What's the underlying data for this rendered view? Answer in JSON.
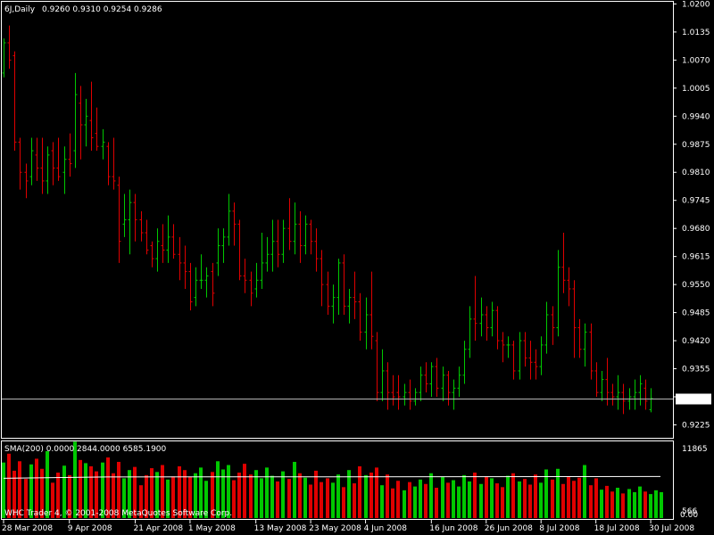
{
  "header": {
    "symbol_timeframe": "6J,Daily",
    "ohlc": "0.9260 0.9310 0.9254 0.9286"
  },
  "indicator": {
    "label": "SMA(200) 0.0000 2844.0000 6585.1900",
    "max_label": "11865",
    "min_label": "566",
    "zero_label": "0.00"
  },
  "footer": {
    "copyright": "WHC Trader 4, © 2001-2008 MetaQuotes Software Corp."
  },
  "current_price": "0.9286",
  "colors": {
    "background": "#000000",
    "up": "#00c800",
    "down": "#e00000",
    "frame": "#ffffff",
    "price_line": "#b4b4b4",
    "sma": "#ffffff"
  },
  "chart_data": [
    {
      "type": "ohlc",
      "price_axis": {
        "ticks": [
          "1.0200",
          "1.0135",
          "1.0070",
          "1.0005",
          "0.9940",
          "0.9875",
          "0.9810",
          "0.9745",
          "0.9680",
          "0.9615",
          "0.9550",
          "0.9485",
          "0.9420",
          "0.9355",
          "0.9290",
          "0.9225"
        ],
        "range": [
          0.9195,
          1.0205
        ]
      },
      "x_labels": [
        {
          "label": "28 Mar 2008",
          "bar": 0
        },
        {
          "label": "9 Apr 2008",
          "bar": 12
        },
        {
          "label": "21 Apr 2008",
          "bar": 24
        },
        {
          "label": "1 May 2008",
          "bar": 34
        },
        {
          "label": "13 May 2008",
          "bar": 46
        },
        {
          "label": "23 May 2008",
          "bar": 56
        },
        {
          "label": "4 Jun 2008",
          "bar": 66
        },
        {
          "label": "16 Jun 2008",
          "bar": 78
        },
        {
          "label": "26 Jun 2008",
          "bar": 88
        },
        {
          "label": "8 Jul 2008",
          "bar": 98
        },
        {
          "label": "18 Jul 2008",
          "bar": 108
        },
        {
          "label": "30 Jul 2008",
          "bar": 118
        }
      ],
      "bars": [
        [
          1.004,
          1.012,
          1.003,
          1.011
        ],
        [
          1.011,
          1.015,
          1.005,
          1.007
        ],
        [
          1.008,
          1.009,
          0.986,
          0.988
        ],
        [
          0.988,
          0.989,
          0.977,
          0.981
        ],
        [
          0.981,
          0.983,
          0.975,
          0.979
        ],
        [
          0.98,
          0.989,
          0.978,
          0.986
        ],
        [
          0.985,
          0.989,
          0.979,
          0.982
        ],
        [
          0.982,
          0.989,
          0.976,
          0.979
        ],
        [
          0.979,
          0.987,
          0.976,
          0.985
        ],
        [
          0.986,
          0.988,
          0.978,
          0.982
        ],
        [
          0.982,
          0.989,
          0.979,
          0.98
        ],
        [
          0.981,
          0.987,
          0.976,
          0.984
        ],
        [
          0.984,
          0.99,
          0.98,
          0.983
        ],
        [
          0.986,
          1.004,
          0.982,
          0.999
        ],
        [
          0.997,
          1.001,
          0.984,
          0.992
        ],
        [
          0.992,
          0.998,
          0.987,
          0.994
        ],
        [
          0.993,
          1.002,
          0.986,
          0.989
        ],
        [
          0.99,
          0.996,
          0.986,
          0.987
        ],
        [
          0.987,
          0.991,
          0.984,
          0.988
        ],
        [
          0.987,
          0.988,
          0.978,
          0.98
        ],
        [
          0.98,
          0.989,
          0.977,
          0.979
        ],
        [
          0.978,
          0.98,
          0.96,
          0.965
        ],
        [
          0.969,
          0.976,
          0.966,
          0.97
        ],
        [
          0.97,
          0.977,
          0.962,
          0.974
        ],
        [
          0.974,
          0.976,
          0.965,
          0.97
        ],
        [
          0.97,
          0.972,
          0.965,
          0.967
        ],
        [
          0.967,
          0.97,
          0.962,
          0.963
        ],
        [
          0.964,
          0.965,
          0.959,
          0.961
        ],
        [
          0.961,
          0.968,
          0.958,
          0.965
        ],
        [
          0.964,
          0.969,
          0.96,
          0.963
        ],
        [
          0.963,
          0.971,
          0.96,
          0.966
        ],
        [
          0.966,
          0.969,
          0.961,
          0.962
        ],
        [
          0.962,
          0.966,
          0.956,
          0.96
        ],
        [
          0.96,
          0.964,
          0.954,
          0.958
        ],
        [
          0.958,
          0.96,
          0.949,
          0.951
        ],
        [
          0.952,
          0.959,
          0.95,
          0.956
        ],
        [
          0.956,
          0.962,
          0.954,
          0.956
        ],
        [
          0.956,
          0.959,
          0.952,
          0.957
        ],
        [
          0.958,
          0.96,
          0.95,
          0.953
        ],
        [
          0.96,
          0.968,
          0.957,
          0.964
        ],
        [
          0.964,
          0.968,
          0.96,
          0.966
        ],
        [
          0.966,
          0.976,
          0.964,
          0.972
        ],
        [
          0.972,
          0.974,
          0.964,
          0.969
        ],
        [
          0.969,
          0.97,
          0.956,
          0.957
        ],
        [
          0.957,
          0.961,
          0.953,
          0.956
        ],
        [
          0.956,
          0.958,
          0.95,
          0.953
        ],
        [
          0.954,
          0.96,
          0.952,
          0.956
        ],
        [
          0.956,
          0.967,
          0.954,
          0.96
        ],
        [
          0.96,
          0.966,
          0.958,
          0.962
        ],
        [
          0.962,
          0.97,
          0.958,
          0.965
        ],
        [
          0.965,
          0.97,
          0.959,
          0.962
        ],
        [
          0.962,
          0.97,
          0.96,
          0.968
        ],
        [
          0.968,
          0.975,
          0.963,
          0.965
        ],
        [
          0.965,
          0.974,
          0.962,
          0.969
        ],
        [
          0.969,
          0.972,
          0.96,
          0.964
        ],
        [
          0.964,
          0.971,
          0.962,
          0.969
        ],
        [
          0.969,
          0.97,
          0.962,
          0.965
        ],
        [
          0.965,
          0.968,
          0.958,
          0.961
        ],
        [
          0.961,
          0.963,
          0.95,
          0.955
        ],
        [
          0.955,
          0.958,
          0.948,
          0.95
        ],
        [
          0.95,
          0.955,
          0.946,
          0.952
        ],
        [
          0.952,
          0.961,
          0.948,
          0.96
        ],
        [
          0.96,
          0.962,
          0.948,
          0.95
        ],
        [
          0.95,
          0.954,
          0.946,
          0.952
        ],
        [
          0.952,
          0.958,
          0.947,
          0.951
        ],
        [
          0.951,
          0.953,
          0.942,
          0.944
        ],
        [
          0.944,
          0.952,
          0.94,
          0.948
        ],
        [
          0.948,
          0.958,
          0.94,
          0.943
        ],
        [
          0.942,
          0.944,
          0.928,
          0.93
        ],
        [
          0.93,
          0.94,
          0.928,
          0.935
        ],
        [
          0.935,
          0.937,
          0.926,
          0.93
        ],
        [
          0.93,
          0.934,
          0.927,
          0.929
        ],
        [
          0.93,
          0.934,
          0.926,
          0.929
        ],
        [
          0.929,
          0.932,
          0.927,
          0.93
        ],
        [
          0.93,
          0.933,
          0.926,
          0.928
        ],
        [
          0.928,
          0.931,
          0.927,
          0.93
        ],
        [
          0.93,
          0.936,
          0.928,
          0.934
        ],
        [
          0.934,
          0.937,
          0.93,
          0.932
        ],
        [
          0.932,
          0.937,
          0.929,
          0.936
        ],
        [
          0.936,
          0.938,
          0.929,
          0.931
        ],
        [
          0.931,
          0.936,
          0.928,
          0.934
        ],
        [
          0.934,
          0.935,
          0.927,
          0.93
        ],
        [
          0.93,
          0.933,
          0.926,
          0.931
        ],
        [
          0.931,
          0.936,
          0.929,
          0.934
        ],
        [
          0.934,
          0.942,
          0.932,
          0.94
        ],
        [
          0.94,
          0.95,
          0.938,
          0.947
        ],
        [
          0.947,
          0.957,
          0.942,
          0.946
        ],
        [
          0.946,
          0.952,
          0.943,
          0.948
        ],
        [
          0.948,
          0.95,
          0.942,
          0.945
        ],
        [
          0.945,
          0.951,
          0.943,
          0.949
        ],
        [
          0.949,
          0.95,
          0.94,
          0.942
        ],
        [
          0.942,
          0.944,
          0.937,
          0.941
        ],
        [
          0.941,
          0.943,
          0.938,
          0.941
        ],
        [
          0.941,
          0.942,
          0.933,
          0.935
        ],
        [
          0.935,
          0.944,
          0.933,
          0.942
        ],
        [
          0.942,
          0.944,
          0.936,
          0.938
        ],
        [
          0.938,
          0.942,
          0.933,
          0.937
        ],
        [
          0.937,
          0.94,
          0.933,
          0.936
        ],
        [
          0.936,
          0.943,
          0.934,
          0.941
        ],
        [
          0.941,
          0.951,
          0.939,
          0.948
        ],
        [
          0.948,
          0.95,
          0.941,
          0.945
        ],
        [
          0.945,
          0.963,
          0.943,
          0.959
        ],
        [
          0.959,
          0.967,
          0.953,
          0.956
        ],
        [
          0.956,
          0.959,
          0.95,
          0.954
        ],
        [
          0.954,
          0.956,
          0.938,
          0.945
        ],
        [
          0.945,
          0.947,
          0.938,
          0.94
        ],
        [
          0.94,
          0.946,
          0.936,
          0.944
        ],
        [
          0.944,
          0.946,
          0.933,
          0.935
        ],
        [
          0.935,
          0.937,
          0.929,
          0.93
        ],
        [
          0.93,
          0.935,
          0.928,
          0.933
        ],
        [
          0.933,
          0.938,
          0.927,
          0.93
        ],
        [
          0.93,
          0.932,
          0.927,
          0.929
        ],
        [
          0.929,
          0.934,
          0.926,
          0.93
        ],
        [
          0.93,
          0.932,
          0.925,
          0.928
        ],
        [
          0.928,
          0.931,
          0.926,
          0.929
        ],
        [
          0.929,
          0.933,
          0.926,
          0.93
        ],
        [
          0.93,
          0.934,
          0.927,
          0.932
        ],
        [
          0.931,
          0.933,
          0.926,
          0.928
        ],
        [
          0.926,
          0.931,
          0.9254,
          0.9286
        ]
      ]
    },
    {
      "type": "bar",
      "name": "volume",
      "range": [
        0,
        11865
      ],
      "sma": 6585.19,
      "values": [
        8800,
        10200,
        7500,
        9000,
        6200,
        8500,
        9400,
        7800,
        10600,
        5600,
        7200,
        8300,
        6800,
        12100,
        9200,
        8700,
        8200,
        7400,
        8800,
        9600,
        7100,
        8900,
        6300,
        7600,
        8100,
        5200,
        6800,
        7900,
        7300,
        8400,
        6100,
        6600,
        8200,
        7600,
        6500,
        7100,
        8000,
        5900,
        7300,
        9000,
        7700,
        8400,
        6000,
        7200,
        8600,
        6900,
        7600,
        6300,
        8000,
        6700,
        5800,
        7400,
        6200,
        8900,
        7100,
        6400,
        5300,
        7500,
        5700,
        6300,
        5600,
        6900,
        4900,
        7600,
        5500,
        8200,
        6800,
        7200,
        8000,
        5200,
        6900,
        4700,
        5900,
        4400,
        5700,
        5000,
        6100,
        5400,
        7100,
        4800,
        6500,
        5600,
        6000,
        5000,
        6800,
        5800,
        7200,
        5400,
        6600,
        6300,
        5500,
        4900,
        6700,
        7100,
        5800,
        6200,
        5300,
        6900,
        5600,
        7700,
        6100,
        7800,
        5400,
        6600,
        5900,
        6400,
        8400,
        5200,
        6300,
        4500,
        5100,
        4200,
        4800,
        3900,
        4600,
        4100,
        5000,
        4200,
        3800,
        4400,
        4100
      ]
    }
  ]
}
